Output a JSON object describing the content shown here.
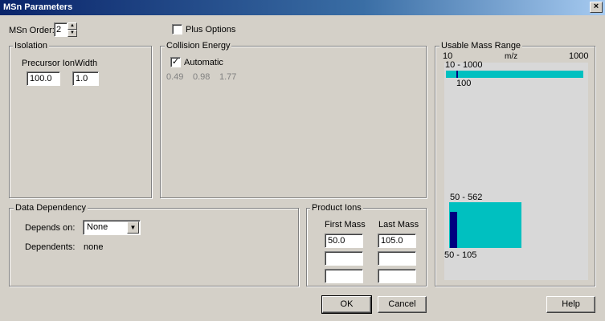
{
  "window": {
    "title": "MSn Parameters",
    "close_glyph": "×"
  },
  "msn_order": {
    "label": "MSn Order:",
    "value": "2",
    "up": "▲",
    "down": "▼"
  },
  "plus_options": {
    "label": "Plus Options",
    "checked": false
  },
  "isolation": {
    "title": "Isolation",
    "precursor_label": "Precursor Ion",
    "width_label": "Width",
    "precursor_value": "100.0",
    "width_value": "1.0"
  },
  "collision": {
    "title": "Collision Energy",
    "automatic_label": "Automatic",
    "automatic_checked": "✓",
    "values": [
      "0.49",
      "0.98",
      "1.77"
    ]
  },
  "data_dependency": {
    "title": "Data Dependency",
    "depends_on_label": "Depends on:",
    "depends_on_value": "None",
    "dependents_label": "Dependents:",
    "dependents_value": "none",
    "dropdown_glyph": "▼"
  },
  "product_ions": {
    "title": "Product Ions",
    "first_mass_label": "First Mass",
    "last_mass_label": "Last Mass",
    "rows": [
      {
        "first": "50.0",
        "last": "105.0"
      },
      {
        "first": "",
        "last": ""
      },
      {
        "first": "",
        "last": ""
      }
    ]
  },
  "usable_mass_range": {
    "title": "Usable Mass Range",
    "axis_min": "10",
    "axis_unit": "m/z",
    "axis_max": "1000",
    "top_range_label": "10 - 1000",
    "top_marker_label": "100",
    "bottom_range_label": "50 - 562",
    "bottom_sub_label": "50 - 105",
    "colors": {
      "range_bar": "#00c0c0",
      "marker": "#000080"
    }
  },
  "buttons": {
    "ok": "OK",
    "cancel": "Cancel",
    "help": "Help"
  }
}
